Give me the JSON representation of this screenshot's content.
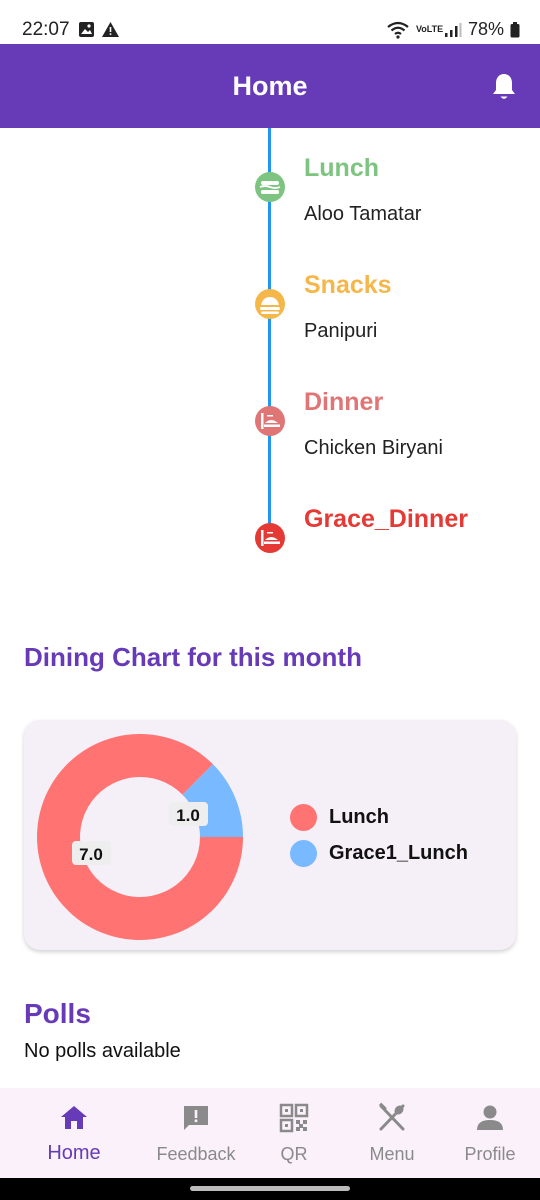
{
  "status_bar": {
    "time": "22:07",
    "battery": "78%",
    "network": "VoLTE"
  },
  "app_bar": {
    "title": "Home"
  },
  "timeline": [
    {
      "title": "Lunch",
      "item": "Aloo Tamatar",
      "color": "#7cc47f"
    },
    {
      "title": "Snacks",
      "item": "Panipuri",
      "color": "#f5b74a"
    },
    {
      "title": "Dinner",
      "item": "Chicken Biryani",
      "color": "#e07575"
    },
    {
      "title": "Grace_Dinner",
      "item": "",
      "color": "#e53935"
    }
  ],
  "dining_chart": {
    "title": "Dining Chart for this month"
  },
  "chart_data": {
    "type": "pie",
    "categories": [
      "Lunch",
      "Grace1_Lunch"
    ],
    "values": [
      7.0,
      1.0
    ],
    "value_labels": [
      "7.0",
      "1.0"
    ],
    "colors": [
      "#ff7373",
      "#78b9ff"
    ]
  },
  "polls": {
    "title": "Polls",
    "empty_text": "No polls available"
  },
  "bottom_nav": [
    {
      "label": "Home",
      "icon": "home-icon",
      "active": true
    },
    {
      "label": "Feedback",
      "icon": "feedback-icon",
      "active": false
    },
    {
      "label": "QR",
      "icon": "qr-code-icon",
      "active": false
    },
    {
      "label": "Menu",
      "icon": "restaurant-menu-icon",
      "active": false
    },
    {
      "label": "Profile",
      "icon": "person-icon",
      "active": false
    }
  ],
  "colors": {
    "primary": "#673ab7",
    "timeline_line": "#2196f3",
    "chart_card_bg": "#f5eff7"
  }
}
